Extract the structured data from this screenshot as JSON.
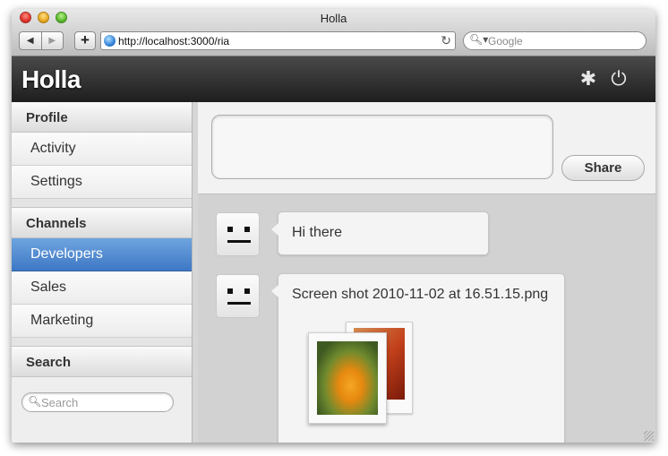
{
  "browser": {
    "window_title": "Holla",
    "back_icon": "◀",
    "forward_icon": "▶",
    "add_icon": "+",
    "url": "http://localhost:3000/ria",
    "reload_icon": "↻",
    "search_placeholder": "Google",
    "search_icon": "🔍︎▾"
  },
  "app": {
    "brand": "Holla",
    "settings_icon": "✱",
    "power_icon": "⏻"
  },
  "sidebar": {
    "profile_header": "Profile",
    "profile_items": [
      {
        "label": "Activity"
      },
      {
        "label": "Settings"
      }
    ],
    "channels_header": "Channels",
    "channel_items": [
      {
        "label": "Developers",
        "active": true
      },
      {
        "label": "Sales",
        "active": false
      },
      {
        "label": "Marketing",
        "active": false
      }
    ],
    "search_header": "Search",
    "search_placeholder": "Search",
    "search_icon": "🔍︎"
  },
  "composer": {
    "value": "",
    "share_label": "Share"
  },
  "feed": {
    "messages": [
      {
        "text": "Hi there"
      },
      {
        "text": "Screen shot 2010-11-02 at 16.51.15.png",
        "attachment": "image"
      }
    ]
  },
  "colors": {
    "header_bg": "#2a2a2a",
    "active_item": "#4a86cf",
    "feed_bg": "#d2d2d2"
  }
}
